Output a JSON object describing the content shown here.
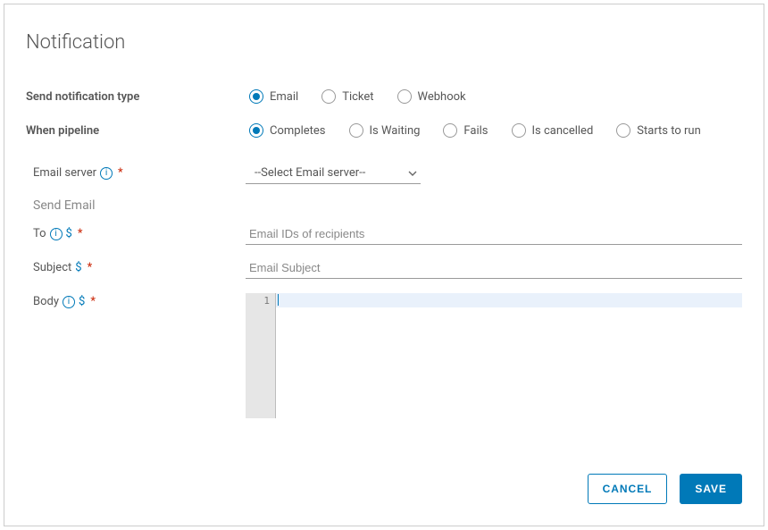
{
  "title": "Notification",
  "rows": {
    "type": {
      "label": "Send notification type",
      "options": {
        "email": "Email",
        "ticket": "Ticket",
        "webhook": "Webhook"
      },
      "selected": "email"
    },
    "when": {
      "label": "When pipeline",
      "options": {
        "completes": "Completes",
        "waiting": "Is Waiting",
        "fails": "Fails",
        "cancelled": "Is cancelled",
        "starts": "Starts to run"
      },
      "selected": "completes"
    }
  },
  "form": {
    "email_server": {
      "label": "Email server",
      "placeholder": "--Select Email server--",
      "required": "*"
    },
    "section_label": "Send Email",
    "to": {
      "label": "To",
      "placeholder": "Email IDs of recipients",
      "required": "*"
    },
    "subject": {
      "label": "Subject",
      "placeholder": "Email Subject",
      "required": "*"
    },
    "body": {
      "label": "Body",
      "required": "*",
      "line_number": "1"
    }
  },
  "footer": {
    "cancel": "CANCEL",
    "save": "SAVE"
  },
  "icons": {
    "info": "i",
    "dollar": "$"
  }
}
